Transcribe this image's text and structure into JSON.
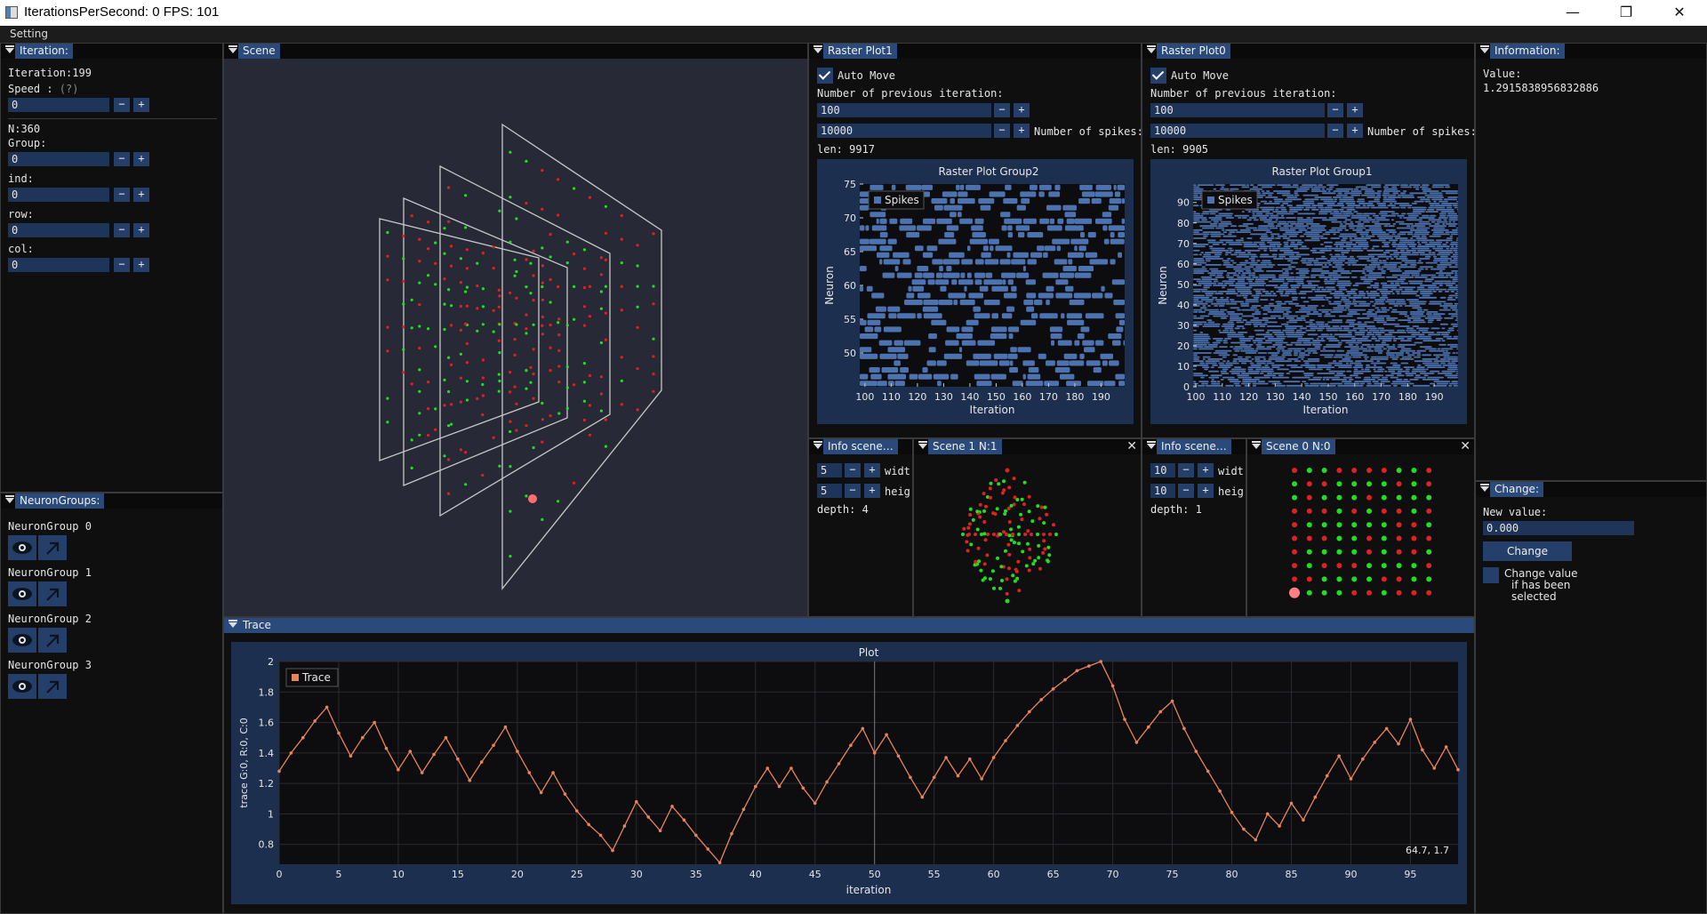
{
  "window": {
    "title": "IterationsPerSecond: 0 FPS: 101",
    "minimize": "—",
    "maximize": "❐",
    "close": "✕"
  },
  "menu": {
    "setting": "Setting"
  },
  "iteration_panel": {
    "tab": "Iteration:",
    "iteration": "Iteration:199",
    "speed_label": "Speed : ",
    "speed_help": "(?)",
    "speed_value": "0",
    "n_label": "N:360",
    "group_label": "Group:",
    "group_value": "0",
    "ind_label": "ind:",
    "ind_value": "0",
    "row_label": "row:",
    "row_value": "0",
    "col_label": "col:",
    "col_value": "0",
    "minus": "−",
    "plus": "+"
  },
  "neuron_groups": {
    "tab": "NeuronGroups:",
    "items": [
      {
        "label": "NeuronGroup 0"
      },
      {
        "label": "NeuronGroup 1"
      },
      {
        "label": "NeuronGroup 2"
      },
      {
        "label": "NeuronGroup 3"
      }
    ]
  },
  "scene": {
    "tab": "Scene"
  },
  "raster1": {
    "tab": "Raster Plot1",
    "auto_move": "Auto Move",
    "prev_label": "Number of previous iteration:",
    "prev_value": "100",
    "spikes_value": "10000",
    "spikes_label": "Number of spikes:",
    "len": "len: 9917"
  },
  "raster0": {
    "tab": "Raster Plot0",
    "auto_move": "Auto Move",
    "prev_label": "Number of previous iteration:",
    "prev_value": "100",
    "spikes_value": "10000",
    "spikes_label": "Number of spikes:",
    "len": "len: 9905"
  },
  "info_scene_left": {
    "tab": "Info scene…",
    "width_value": "5",
    "width_label": "widt",
    "height_value": "5",
    "height_label": "heig",
    "depth": "depth: 4"
  },
  "scene1": {
    "tab": "Scene 1 N:1"
  },
  "info_scene_right": {
    "tab": "Info scene…",
    "width_value": "10",
    "width_label": "widt",
    "height_value": "10",
    "height_label": "heig",
    "depth": "depth: 1"
  },
  "scene0": {
    "tab": "Scene 0 N:0"
  },
  "information": {
    "tab": "Information:",
    "value_label": "Value:",
    "value": "1.2915838956832886"
  },
  "change": {
    "tab": "Change:",
    "new_value_label": "New value:",
    "new_value": "0.000",
    "button": "Change",
    "checkbox_line1": "Change value",
    "checkbox_line2": "if has been",
    "checkbox_line3": "selected"
  },
  "trace": {
    "tab": "Trace"
  },
  "chart_data": [
    {
      "type": "scatter",
      "title": "Raster Plot Group2",
      "xlabel": "Iteration",
      "ylabel": "Neuron",
      "legend": [
        "Spikes"
      ],
      "legend_position": "top-left",
      "xlim": [
        98,
        199
      ],
      "ylim": [
        45,
        75
      ],
      "xticks": [
        100,
        110,
        120,
        130,
        140,
        150,
        160,
        170,
        180,
        190
      ],
      "yticks": [
        50,
        55,
        60,
        65,
        70,
        75
      ],
      "color": "#4c72b0"
    },
    {
      "type": "scatter",
      "title": "Raster Plot Group1",
      "xlabel": "Iteration",
      "ylabel": "Neuron",
      "legend": [
        "Spikes"
      ],
      "legend_position": "top-left",
      "xlim": [
        99,
        199
      ],
      "ylim": [
        0,
        99
      ],
      "xticks": [
        100,
        110,
        120,
        130,
        140,
        150,
        160,
        170,
        180,
        190
      ],
      "yticks": [
        0,
        10,
        20,
        30,
        40,
        50,
        60,
        70,
        80,
        90
      ],
      "color": "#4c72b0"
    },
    {
      "type": "line",
      "title": "Plot",
      "xlabel": "iteration",
      "ylabel": "trace G:0, R:0, C:0",
      "legend": [
        "Trace"
      ],
      "legend_position": "top-left",
      "xlim": [
        0,
        99
      ],
      "ylim": [
        0.67,
        2.0
      ],
      "xticks": [
        0,
        5,
        10,
        15,
        20,
        25,
        30,
        35,
        40,
        45,
        50,
        55,
        60,
        65,
        70,
        75,
        80,
        85,
        90,
        95
      ],
      "yticks": [
        0.8,
        1,
        1.2,
        1.4,
        1.6,
        1.8,
        2
      ],
      "cursor_x": 50,
      "readout": "64.7, 1.7",
      "color": "#e8845a",
      "series": [
        {
          "name": "Trace",
          "x": [
            0,
            1,
            2,
            3,
            4,
            5,
            6,
            7,
            8,
            9,
            10,
            11,
            12,
            13,
            14,
            15,
            16,
            17,
            18,
            19,
            20,
            21,
            22,
            23,
            24,
            25,
            26,
            27,
            28,
            29,
            30,
            31,
            32,
            33,
            34,
            35,
            36,
            37,
            38,
            39,
            40,
            41,
            42,
            43,
            44,
            45,
            46,
            47,
            48,
            49,
            50,
            51,
            52,
            53,
            54,
            55,
            56,
            57,
            58,
            59,
            60,
            61,
            62,
            63,
            64,
            65,
            66,
            67,
            68,
            69,
            70,
            71,
            72,
            73,
            74,
            75,
            76,
            77,
            78,
            79,
            80,
            81,
            82,
            83,
            84,
            85,
            86,
            87,
            88,
            89,
            90,
            91,
            92,
            93,
            94,
            95,
            96,
            97,
            98,
            99
          ],
          "values": [
            1.28,
            1.4,
            1.5,
            1.61,
            1.7,
            1.53,
            1.38,
            1.5,
            1.6,
            1.43,
            1.29,
            1.41,
            1.27,
            1.39,
            1.5,
            1.36,
            1.22,
            1.34,
            1.45,
            1.57,
            1.41,
            1.27,
            1.14,
            1.27,
            1.13,
            1.02,
            0.93,
            0.86,
            0.76,
            0.92,
            1.08,
            0.98,
            0.89,
            1.05,
            0.96,
            0.86,
            0.77,
            0.68,
            0.87,
            1.03,
            1.18,
            1.3,
            1.18,
            1.3,
            1.17,
            1.07,
            1.21,
            1.33,
            1.45,
            1.56,
            1.4,
            1.52,
            1.38,
            1.24,
            1.11,
            1.24,
            1.37,
            1.25,
            1.36,
            1.23,
            1.37,
            1.48,
            1.58,
            1.67,
            1.75,
            1.82,
            1.88,
            1.94,
            1.97,
            2.0,
            1.84,
            1.62,
            1.47,
            1.57,
            1.67,
            1.74,
            1.56,
            1.41,
            1.28,
            1.15,
            1.01,
            0.9,
            0.83,
            1.0,
            0.92,
            1.07,
            0.96,
            1.11,
            1.25,
            1.38,
            1.23,
            1.36,
            1.47,
            1.56,
            1.46,
            1.62,
            1.42,
            1.3,
            1.44,
            1.29
          ]
        }
      ]
    }
  ],
  "colors": {
    "accent": "#294a7a",
    "field": "#1e3459",
    "button": "#24406a",
    "plot_panel": "#1d2f4f",
    "neuron_active": "#22dd22",
    "neuron_inactive": "#dd2222",
    "trace": "#e8845a",
    "spikes": "#4c72b0"
  },
  "icons": {
    "eye": "eye-icon",
    "arrow": "arrow-up-right-icon"
  }
}
